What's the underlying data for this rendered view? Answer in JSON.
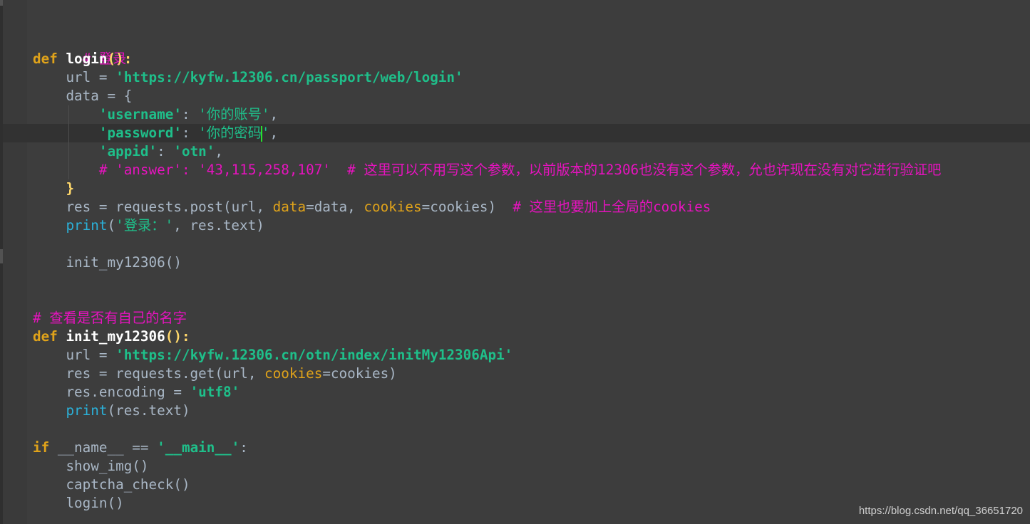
{
  "editor": {
    "language": "Python",
    "theme_colors": {
      "background": "#3d3d3d",
      "keyword": "#e0a31a",
      "string": "#1fbf8a",
      "comment": "#e613be",
      "default": "#a9b7c6",
      "builtin": "#2bb0d8",
      "caret": "#27e02e"
    },
    "lines": {
      "l1_comment": "# 登录",
      "l2_kw": "def",
      "l2_name": "login",
      "l2_rest": "():",
      "l3_var": "url = ",
      "l3_str": "'https://kyfw.12306.cn/passport/web/login'",
      "l4_text": "data = {",
      "l5_key": "'username'",
      "l5_colon": ": ",
      "l5_val": "'你的账号'",
      "l5_comma": ",",
      "l6_key": "'password'",
      "l6_colon": ": ",
      "l6_val_a": "'你的密码",
      "l6_val_b": "'",
      "l6_comma": ",",
      "l7_key": "'appid'",
      "l7_colon": ": ",
      "l7_val": "'otn'",
      "l7_comma": ",",
      "l8_comment": "# 'answer': '43,115,258,107'  # 这里可以不用写这个参数，以前版本的12306也没有这个参数，允也许现在没有对它进行验证吧",
      "l9_text": "}",
      "l10_a": "res = requests.post(url, ",
      "l10_p1": "data",
      "l10_b": "=data, ",
      "l10_p2": "cookies",
      "l10_c": "=cookies)  ",
      "l10_comment": "# 这里也要加上全局的cookies",
      "l11_bi": "print",
      "l11_a": "(",
      "l11_str": "'登录：'",
      "l11_b": ", res.text)",
      "l13_text": "init_my12306()",
      "l16_comment": "# 查看是否有自己的名字",
      "l17_kw": "def",
      "l17_name": "init_my12306",
      "l17_rest": "():",
      "l18_var": "url = ",
      "l18_str": "'https://kyfw.12306.cn/otn/index/initMy12306Api'",
      "l19_a": "res = requests.get(url, ",
      "l19_p": "cookies",
      "l19_b": "=cookies)",
      "l20_a": "res.encoding = ",
      "l20_str": "'utf8'",
      "l21_bi": "print",
      "l21_a": "(res.text)",
      "l23_kw": "if",
      "l23_a": " __name__ == ",
      "l23_str": "'__main__'",
      "l23_b": ":",
      "l24_text": "show_img()",
      "l25_text": "captcha_check()",
      "l26_text": "login()"
    }
  },
  "watermark": "https://blog.csdn.net/qq_36651720"
}
